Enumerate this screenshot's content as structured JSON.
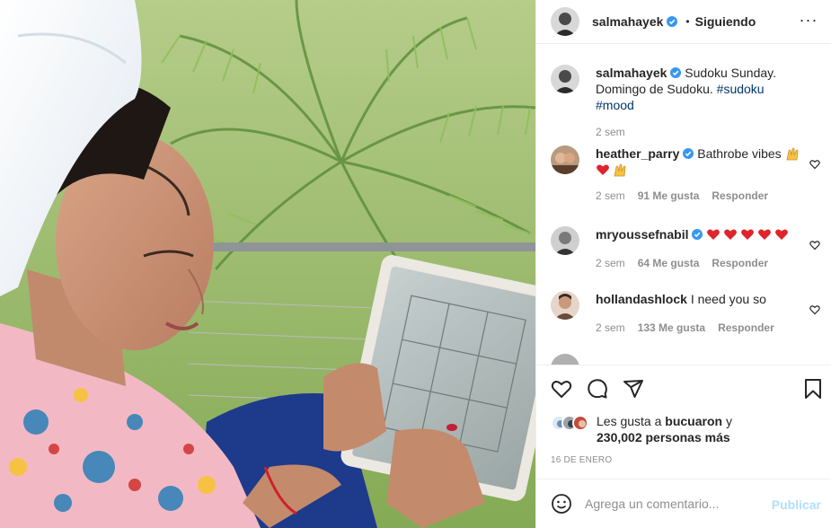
{
  "post": {
    "author": "salmahayek",
    "follow_status": "Siguiendo",
    "dot": "•",
    "more": "···"
  },
  "caption": {
    "author": "salmahayek",
    "text": "Sudoku Sunday. Domingo de Sudoku.",
    "tags": [
      "#sudoku",
      "#mood"
    ],
    "time": "2 sem"
  },
  "comments": [
    {
      "author": "heather_parry",
      "verified": true,
      "text": "Bathrobe vibes",
      "emoji": [
        "raising-hands",
        "heart",
        "raising-hands"
      ],
      "time": "2 sem",
      "likes": "91 Me gusta",
      "reply": "Responder"
    },
    {
      "author": "mryoussefnabil",
      "verified": true,
      "text": "",
      "emoji": [
        "heart",
        "heart",
        "heart",
        "heart",
        "heart"
      ],
      "time": "2 sem",
      "likes": "64 Me gusta",
      "reply": "Responder"
    },
    {
      "author": "hollandashlock",
      "verified": false,
      "text": "I need you so",
      "emoji": [],
      "time": "2 sem",
      "likes": "133 Me gusta",
      "reply": "Responder"
    }
  ],
  "actions": {
    "like_icon": "heart-icon",
    "comment_icon": "comment-icon",
    "share_icon": "paper-plane-icon",
    "save_icon": "bookmark-icon"
  },
  "likes": {
    "prefix": "Les gusta a",
    "user": "bucuaron",
    "suffix": "y",
    "count": "230,002 personas más"
  },
  "date": "16 DE ENERO",
  "add_comment": {
    "placeholder": "Agrega un comentario...",
    "publish": "Publicar"
  },
  "colors": {
    "verified": "#3897f0",
    "link": "#00376b",
    "publish_disabled": "#b2dffc",
    "heart": "#ed4956"
  }
}
